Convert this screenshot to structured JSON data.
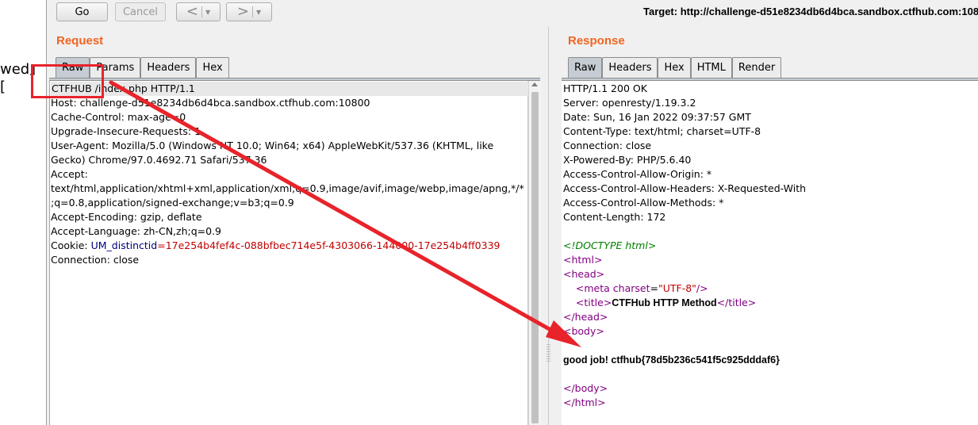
{
  "background_fragment": "wed」[",
  "toolbar": {
    "go_label": "Go",
    "cancel_label": "Cancel",
    "back_glyph": "<",
    "forward_glyph": ">",
    "dropdown_glyph": "▼",
    "target": "Target: http://challenge-d51e8234db6d4bca.sandbox.ctfhub.com:108"
  },
  "request": {
    "title": "Request",
    "tabs": [
      "Raw",
      "Params",
      "Headers",
      "Hex"
    ],
    "active_tab": "Raw",
    "lines": [
      "CTFHUB /index.php HTTP/1.1",
      "Host: challenge-d51e8234db6d4bca.sandbox.ctfhub.com:10800",
      "Cache-Control: max-age=0",
      "Upgrade-Insecure-Requests: 1",
      "User-Agent: Mozilla/5.0 (Windows NT 10.0; Win64; x64) AppleWebKit/537.36 (KHTML, like",
      "Gecko) Chrome/97.0.4692.71 Safari/537.36",
      "Accept:",
      "text/html,application/xhtml+xml,application/xml;q=0.9,image/avif,image/webp,image/apng,*/*",
      ";q=0.8,application/signed-exchange;v=b3;q=0.9",
      "Accept-Encoding: gzip, deflate",
      "Accept-Language: zh-CN,zh;q=0.9"
    ],
    "cookie_label": "Cookie:",
    "cookie_key": "UM_distinctid",
    "cookie_eq": "=",
    "cookie_value": "17e254b4fef4c-088bfbec714e5f-4303066-144000-17e254b4ff0339",
    "last_line": "Connection: close"
  },
  "response": {
    "title": "Response",
    "tabs": [
      "Raw",
      "Headers",
      "Hex",
      "HTML",
      "Render"
    ],
    "active_tab": "Raw",
    "header_lines": [
      "HTTP/1.1 200 OK",
      "Server: openresty/1.19.3.2",
      "Date: Sun, 16 Jan 2022 09:37:57 GMT",
      "Content-Type: text/html; charset=UTF-8",
      "Connection: close",
      "X-Powered-By: PHP/5.6.40",
      "Access-Control-Allow-Origin: *",
      "Access-Control-Allow-Headers: X-Requested-With",
      "Access-Control-Allow-Methods: *",
      "Content-Length: 172"
    ],
    "doctype": "<!DOCTYPE html>",
    "html_open": "<html>",
    "head_open": "<head>",
    "meta_open": "<meta",
    "meta_attr": "charset",
    "meta_eq": "=",
    "meta_val": "\"UTF-8\"",
    "meta_close": "/>",
    "title_open": "<title>",
    "title_text": "CTFHub HTTP Method",
    "title_close": "</title>",
    "head_close": "</head>",
    "body_open": "<body>",
    "flag_line": "good job! ctfhub{78d5b236c541f5c925dddaf6}",
    "body_close": "</body>",
    "html_close": "</html>"
  },
  "colors": {
    "accent_title": "#f26522",
    "annotation": "#e8232a",
    "cookie_key": "#000080",
    "cookie_value": "#c00000",
    "html_tag": "#800080",
    "doctype": "#008000"
  }
}
